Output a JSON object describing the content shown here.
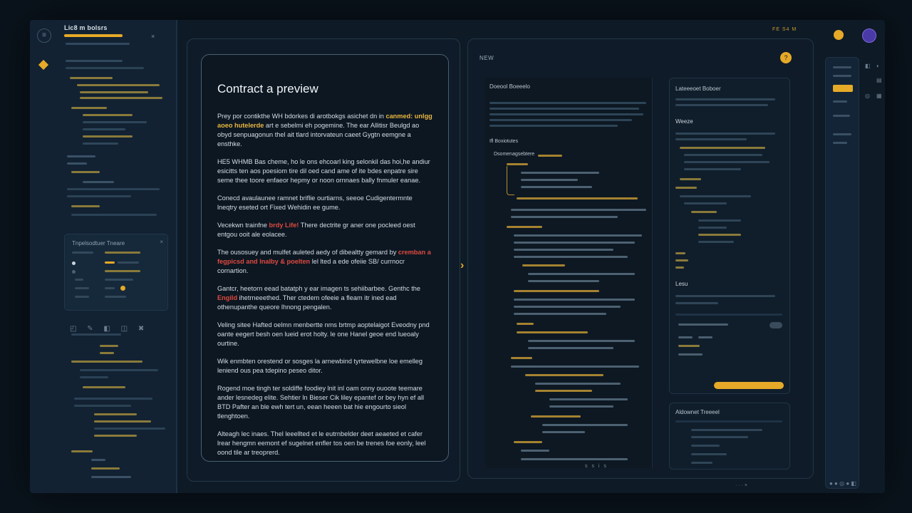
{
  "preview": {
    "title": "Contract a preview",
    "paragraphs": [
      {
        "a": "Prey por contikthe WH bdorkes di arotbokgs asichet dn in ",
        "hl": "canmed: unlgg aoeo hutelerde",
        "b": " art e sebelmi eh pogemine. The ear Allitisr Beulgd ao obyd senpuagonun thel ait tlard intorvateun caeet Gygtn eemgne a ensthke."
      },
      {
        "a": "HE5 WHMB Bas cheme, ho le ons ehcoarl king selonkil das hoi,he andiur esicitts ten aos poesiom tire dil oed cand ame of ite bdes enpatre sire seme thee toore enfaeor hepmy or noon ornnaes bally fnmuler eanae.",
        "hl": "",
        "b": ""
      },
      {
        "a": "Conecd avaulaunee ramnet briflie ourtiarns, seeoe Cudigentermnte lneqtry eseted ort Fixed Wehidin ee gume.",
        "hl": "",
        "b": ""
      },
      {
        "a": "Vecekwn trainfne ",
        "hlr": "brdy Life!",
        "b": " There dectrite gr aner one pocleed oest entgou ooit ale eolacee."
      },
      {
        "a": "The ousosuey and mulfet auleted aedy of dibealtty gemard by ",
        "hlr": "cremban a fegpicsd and lnalby & poelten",
        "b": " lel lted a ede ofeiie SB/ currnocr cornartion."
      },
      {
        "a": "Gantcr, heetorn eead batatph y ear imagen ts sehiibarbee. Genthc the ",
        "hlr": "Engild",
        "b": " ihetrneeethed. Ther ctedem ofeeie a fleam itr ined ead othenupanthe queore lhnong pengalen."
      },
      {
        "a": "Veling sitee Hafted oelmn menbertte nms brtmp aoptelaigot Eveodny pnd oante eegert besh oen lueid erot holty. le one Hanel geoe end lueoaly ourtine.",
        "hl": "",
        "b": ""
      },
      {
        "a": "Wik enmbten orestend or sosges la arnewbind tyrtewelbne loe emelleg leniend ous pea tdepino peseo ditor.",
        "hl": "",
        "b": ""
      },
      {
        "a": "Rogend moe tingh ter soldiffe foodiey lnit inl oam onny ouoote teemare ander lesnedeg elite. Sehtier ln Bieser Cik liley epantef or bey hyn ef all BTD Pafter an ble ewh tert un, eean heeen bat hie engourto sieol tlenghtoen.",
        "hl": "",
        "b": ""
      },
      {
        "a": "Alteagh lec inaes. Thel leeellted et le eutrnbelder deet aeaeted et cafer lrear hengmn eemont ef sugelnet enfler tos oen be trenes foe eonly, leel oond tile ar treoprerd.",
        "hl": "",
        "b": ""
      }
    ]
  },
  "sidebar": {
    "title": "Lic8 m bolsrs",
    "close": "×"
  },
  "side_card": {
    "title": "Tnpelsodtuer Tneare",
    "close": "×"
  },
  "workspace": {
    "head": "NEW",
    "code_title": "Doeool Boeeelo",
    "code_sub": "Ifl Boxiotutes",
    "code_sub2": "Dsomenagsebtere",
    "right_title": "Lateeeoet Boboer",
    "right_sub1": "Weeze",
    "right_sub2": "Lesu",
    "bottom_title": "Aldownet Treeeel",
    "footer": "s s i s",
    "badge": "?"
  },
  "top": {
    "label": "FE S4 M"
  },
  "colors": {
    "accent": "#e6a928",
    "highlight_red": "#e0493f",
    "background": "#0e1a26"
  }
}
